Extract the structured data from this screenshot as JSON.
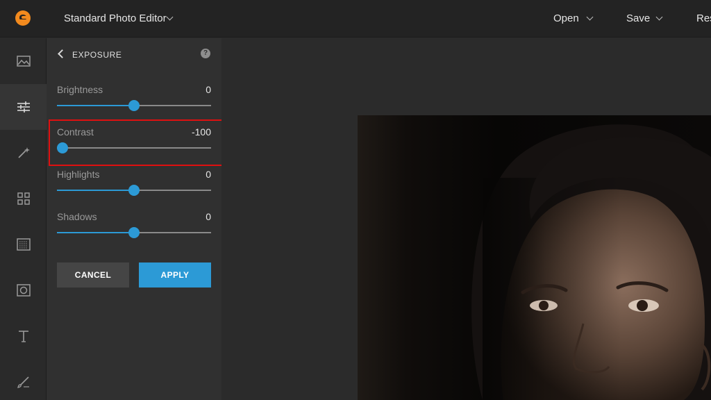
{
  "app": {
    "title": "Standard Photo Editor",
    "menu": {
      "open": "Open",
      "save": "Save",
      "reset": "Res"
    }
  },
  "rail": {
    "items": [
      {
        "icon": "image-icon"
      },
      {
        "icon": "sliders-icon",
        "active": true
      },
      {
        "icon": "magic-wand-icon"
      },
      {
        "icon": "grid-icon"
      },
      {
        "icon": "texture-icon"
      },
      {
        "icon": "frame-icon"
      },
      {
        "icon": "text-icon",
        "glyph": "T"
      },
      {
        "icon": "brush-icon"
      }
    ]
  },
  "panel": {
    "title": "EXPOSURE",
    "help": "?",
    "sliders": [
      {
        "label": "Brightness",
        "value": "0",
        "position": 0.5
      },
      {
        "label": "Contrast",
        "value": "-100",
        "position": 0.0
      },
      {
        "label": "Highlights",
        "value": "0",
        "position": 0.5
      },
      {
        "label": "Shadows",
        "value": "0",
        "position": 0.5
      }
    ],
    "cancel_label": "CANCEL",
    "apply_label": "APPLY"
  },
  "colors": {
    "accent": "#2c9ad6",
    "highlight_box": "#e01010",
    "logo": "#f28a1e"
  }
}
